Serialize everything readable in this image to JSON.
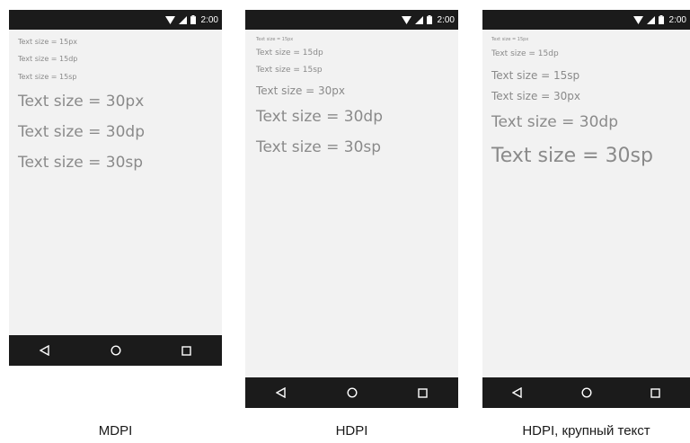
{
  "status_bar": {
    "time": "2:00",
    "icons": [
      "wifi-icon",
      "signal-icon",
      "battery-icon"
    ]
  },
  "nav_bar": {
    "icons": [
      "back-triangle-icon",
      "home-circle-icon",
      "recents-square-icon"
    ]
  },
  "colors": {
    "bar": "#1b1b1b",
    "screen": "#f2f2f2",
    "text": "#8a8a8a"
  },
  "phones": [
    {
      "label": "MDPI",
      "lines": [
        "Text size = 15px",
        "Text size = 15dp",
        "Text size = 15sp",
        "Text size = 30px",
        "Text size = 30dp",
        "Text size = 30sp"
      ]
    },
    {
      "label": "HDPI",
      "lines": [
        "Text size = 15px",
        "Text size = 15dp",
        "Text size = 15sp",
        "Text size = 30px",
        "Text size = 30dp",
        "Text size = 30sp"
      ]
    },
    {
      "label": "HDPI, крупный текст",
      "lines": [
        "Text size = 15px",
        "Text size = 15dp",
        "Text size = 15sp",
        "Text size = 30px",
        "Text size = 30dp",
        "Text size = 30sp"
      ]
    }
  ]
}
